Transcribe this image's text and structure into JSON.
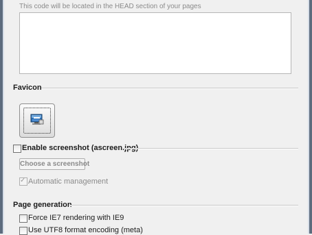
{
  "head_section": {
    "hint": "This code will be located in the HEAD section of your pages",
    "textarea_value": ""
  },
  "favicon": {
    "title": "Favicon",
    "button_icon": "screen-monitor-icon"
  },
  "screenshot": {
    "enable_label": "Enable screenshot (ascreen.jpg)",
    "enable_checked": false,
    "choose_button": "Choose a screenshot",
    "automatic_label": "Automatic management",
    "automatic_checked": true
  },
  "page_generation": {
    "title": "Page generation",
    "options": [
      {
        "label": "Force IE7 rendering with IE9",
        "checked": false
      },
      {
        "label": "Use UTF8 format encoding (meta)",
        "checked": false
      }
    ]
  },
  "colors": {
    "background": "#f0f0f0",
    "window_edge": "#5d6c7e",
    "disabled_text": "#8a8a8a"
  }
}
